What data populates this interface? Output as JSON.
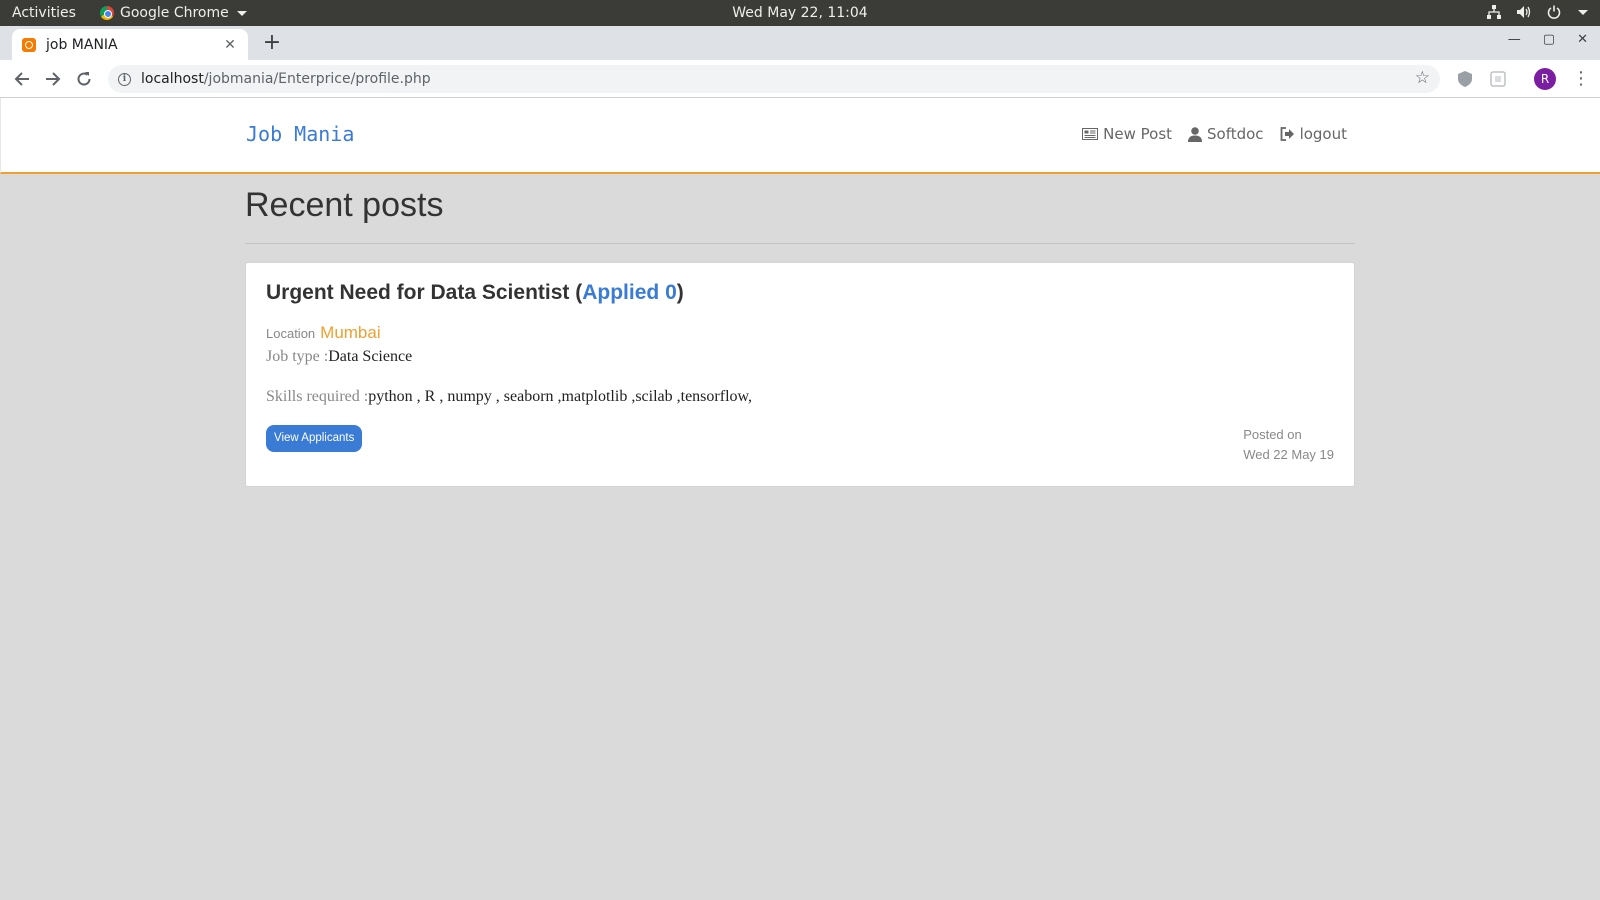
{
  "os": {
    "activities": "Activities",
    "app_name": "Google Chrome",
    "clock": "Wed May 22, 11:04"
  },
  "browser": {
    "tab_title": "job MANIA",
    "url_host": "localhost",
    "url_path": "/jobmania/Enterprice/profile.php",
    "profile_initial": "R"
  },
  "site": {
    "brand": "Job Mania",
    "nav": {
      "new_post": "New Post",
      "user": "Softdoc",
      "logout": "logout"
    }
  },
  "main": {
    "heading": "Recent posts",
    "posts": [
      {
        "title": "Urgent Need for Data Scientist (",
        "applied": "Applied 0",
        "title_close": ")",
        "location_label": "Location",
        "location": "Mumbai",
        "job_type_label": "Job type :",
        "job_type": "Data Science",
        "skills_label": "Skills required :",
        "skills": "python , R , numpy , seaborn ,matplotlib ,scilab ,tensorflow,",
        "button": "View Applicants",
        "posted_label": "Posted on",
        "posted_date": "Wed 22 May 19"
      }
    ]
  },
  "colors": {
    "accent": "#3a7bd5",
    "orange": "#f0a030",
    "page_bg": "#dadada"
  }
}
